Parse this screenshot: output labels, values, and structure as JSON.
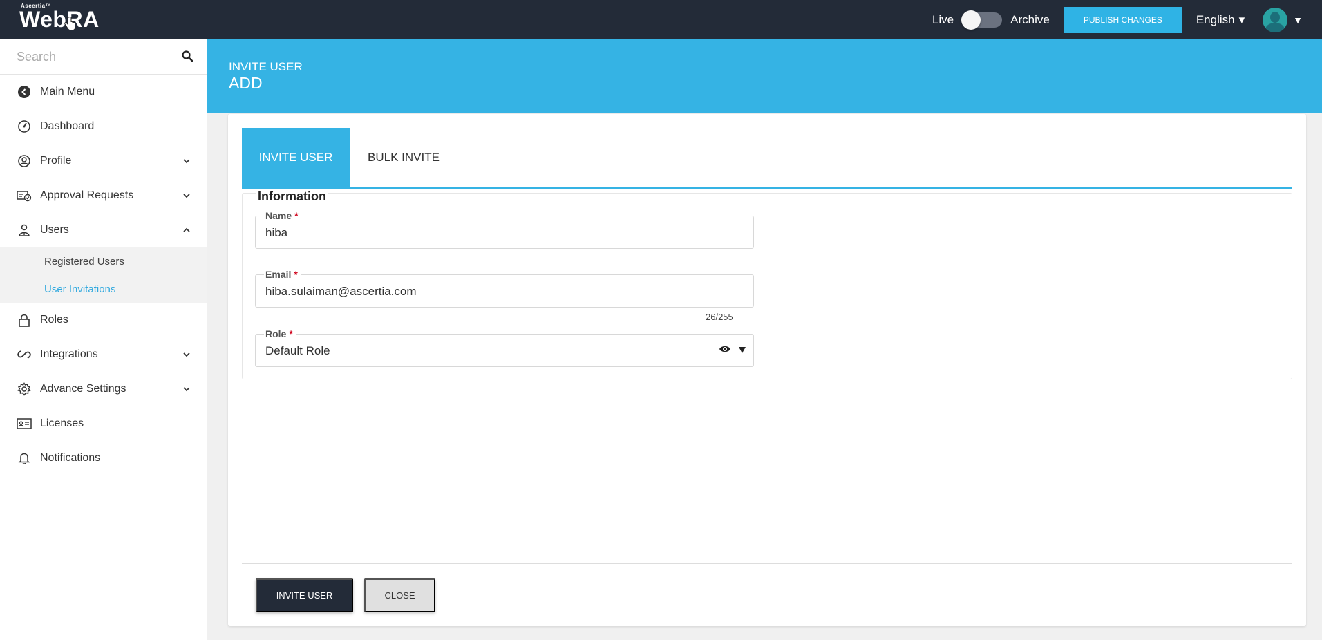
{
  "header": {
    "logo_small": "Ascertia™",
    "logo_text": "WebRA",
    "live_label": "Live",
    "archive_label": "Archive",
    "publish_label": "PUBLISH CHANGES",
    "language": "English",
    "colors": {
      "topbar": "#232b38",
      "accent": "#2fb3e5"
    }
  },
  "sidebar": {
    "search_placeholder": "Search",
    "items": [
      {
        "label": "Main Menu",
        "icon": "back-circle-icon"
      },
      {
        "label": "Dashboard",
        "icon": "dashboard-icon"
      },
      {
        "label": "Profile",
        "icon": "user-circle-icon",
        "expandable": true
      },
      {
        "label": "Approval Requests",
        "icon": "approval-icon",
        "expandable": true
      },
      {
        "label": "Users",
        "icon": "users-icon",
        "expanded": true
      },
      {
        "label": "Roles",
        "icon": "lock-icon"
      },
      {
        "label": "Integrations",
        "icon": "link-icon",
        "expandable": true
      },
      {
        "label": "Advance Settings",
        "icon": "gear-icon",
        "expandable": true
      },
      {
        "label": "Licenses",
        "icon": "license-card-icon"
      },
      {
        "label": "Notifications",
        "icon": "bell-icon"
      }
    ],
    "users_sub": [
      {
        "label": "Registered Users"
      },
      {
        "label": "User Invitations",
        "active": true
      }
    ]
  },
  "banner": {
    "subtitle": "INVITE USER",
    "title": "ADD"
  },
  "tabs": [
    {
      "label": "INVITE USER",
      "active": true
    },
    {
      "label": "BULK INVITE"
    }
  ],
  "form": {
    "section_title": "Information",
    "name": {
      "label": "Name",
      "value": "hiba"
    },
    "email": {
      "label": "Email",
      "value": "hiba.sulaiman@ascertia.com",
      "counter": "26/255"
    },
    "role": {
      "label": "Role",
      "value": "Default Role"
    },
    "required_mark": "*"
  },
  "actions": {
    "invite_label": "INVITE USER",
    "close_label": "CLOSE"
  }
}
